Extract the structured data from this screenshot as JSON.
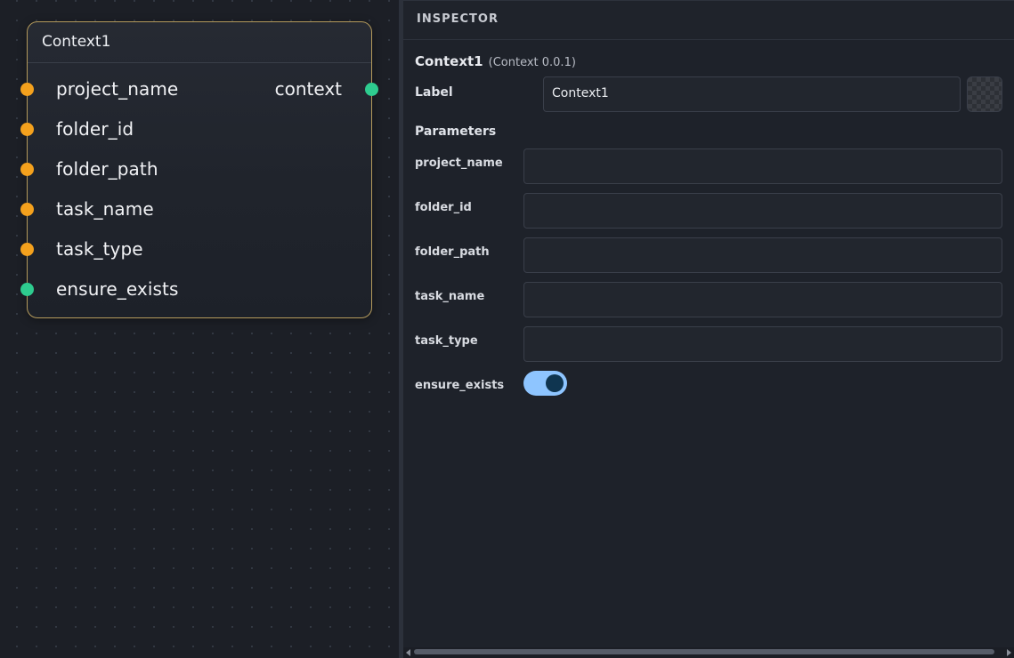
{
  "canvas": {
    "node": {
      "title": "Context1",
      "inputs": [
        {
          "name": "project_name",
          "color": "#f4a11d"
        },
        {
          "name": "folder_id",
          "color": "#f4a11d"
        },
        {
          "name": "folder_path",
          "color": "#f4a11d"
        },
        {
          "name": "task_name",
          "color": "#f4a11d"
        },
        {
          "name": "task_type",
          "color": "#f4a11d"
        },
        {
          "name": "ensure_exists",
          "color": "#2ecc8f"
        }
      ],
      "output": {
        "name": "context",
        "color": "#2ecc8f"
      }
    }
  },
  "inspector": {
    "header": "INSPECTOR",
    "node_title": "Context1",
    "node_type": "(Context 0.0.1)",
    "label_caption": "Label",
    "label_value": "Context1",
    "parameters_caption": "Parameters",
    "parameters": [
      {
        "name": "project_name",
        "value": ""
      },
      {
        "name": "folder_id",
        "value": ""
      },
      {
        "name": "folder_path",
        "value": ""
      },
      {
        "name": "task_name",
        "value": ""
      },
      {
        "name": "task_type",
        "value": ""
      }
    ],
    "ensure_exists": {
      "name": "ensure_exists",
      "enabled": true
    }
  },
  "colors": {
    "input_port": "#f4a11d",
    "bool_port": "#2ecc8f",
    "node_border": "#b49a5c",
    "toggle_on": "#8ec5ff"
  }
}
